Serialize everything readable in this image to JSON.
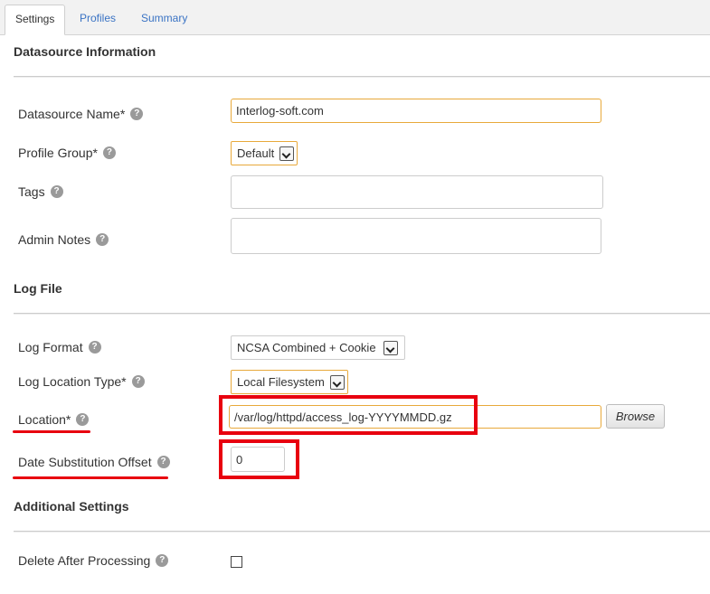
{
  "tabs": [
    "Settings",
    "Profiles",
    "Summary"
  ],
  "sections": {
    "datasource": "Datasource Information",
    "logfile": "Log File",
    "additional": "Additional Settings"
  },
  "fields": {
    "datasource_name": {
      "label": "Datasource Name*",
      "value": "Interlog-soft.com"
    },
    "profile_group": {
      "label": "Profile Group*",
      "value": "Default"
    },
    "tags": {
      "label": "Tags",
      "value": ""
    },
    "admin_notes": {
      "label": "Admin Notes",
      "value": ""
    },
    "log_format": {
      "label": "Log Format",
      "value": "NCSA Combined + Cookie"
    },
    "log_location_type": {
      "label": "Log Location Type*",
      "value": "Local Filesystem"
    },
    "location": {
      "label": "Location*",
      "value": "/var/log/httpd/access_log-YYYYMMDD.gz",
      "browse_label": "Browse"
    },
    "date_offset": {
      "label": "Date Substitution Offset",
      "value": "0"
    },
    "delete_after": {
      "label": "Delete After Processing",
      "checked": false
    }
  },
  "help_glyph": "?",
  "colors": {
    "link": "#3a73c4",
    "focus_border": "#e8a93b",
    "annotation": "#e8000f"
  }
}
